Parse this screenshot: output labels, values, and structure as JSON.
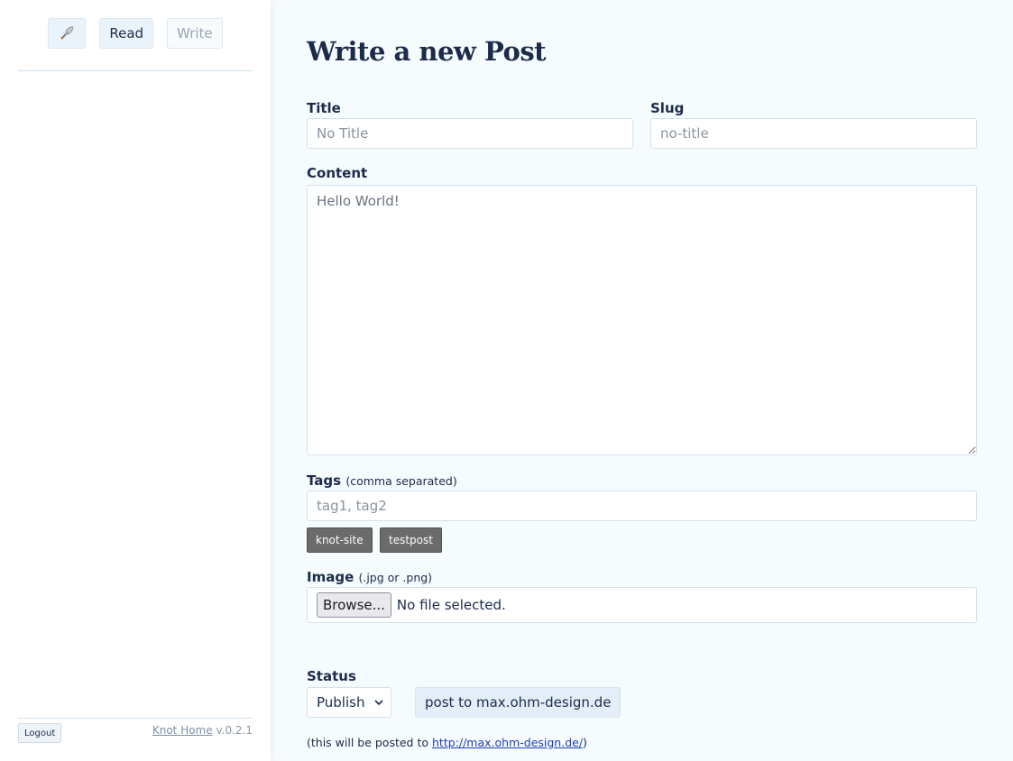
{
  "sidebar": {
    "nav": {
      "home_icon": "quill-icon",
      "read_label": "Read",
      "write_label": "Write"
    },
    "footer": {
      "logout_label": "Logout",
      "home_link": "Knot Home",
      "version": "v.0.2.1"
    }
  },
  "main": {
    "heading": "Write a new Post",
    "title_field": {
      "label": "Title",
      "placeholder": "No Title"
    },
    "slug_field": {
      "label": "Slug",
      "placeholder": "no-title"
    },
    "content_field": {
      "label": "Content",
      "placeholder": "Hello World!"
    },
    "tags_field": {
      "label": "Tags",
      "hint": "(comma separated)",
      "placeholder": "tag1, tag2",
      "existing_tags": [
        "knot-site",
        "testpost"
      ]
    },
    "image_field": {
      "label": "Image",
      "hint": "(.jpg or .png)",
      "browse_label": "Browse...",
      "file_status": "No file selected."
    },
    "status_field": {
      "label": "Status",
      "selected": "Publish"
    },
    "post_button": "post to max.ohm-design.de",
    "note": {
      "prefix": "(this will be posted to ",
      "link": "http://max.ohm-design.de/",
      "suffix": ")"
    }
  },
  "colors": {
    "text": "#1c2b4a",
    "main_bg": "#f6fbfe",
    "nav_active_bg": "#eaf3fa",
    "tag_bg": "#6b6b6b",
    "link": "#1a3fbf"
  }
}
